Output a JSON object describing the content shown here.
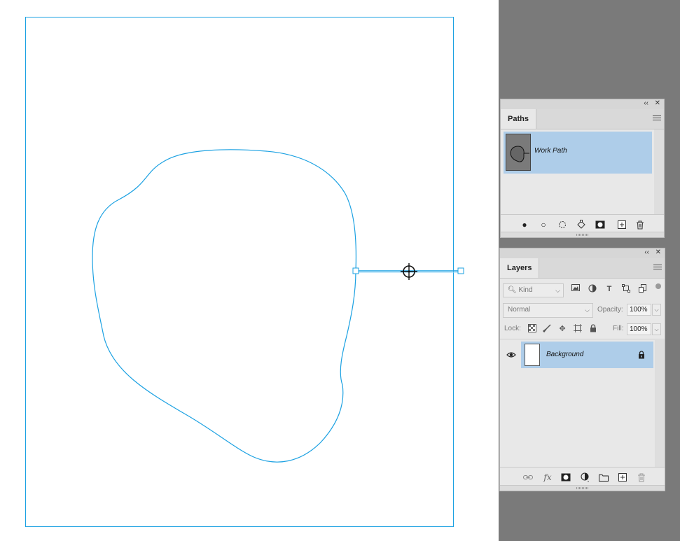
{
  "canvas": {
    "document": "white-document-canvas",
    "path_color": "#1ba1e2",
    "selected_anchor": "path-anchor-point",
    "cursor": "convert-point-crosshair-icon"
  },
  "paths_panel": {
    "tab_label": "Paths",
    "collapse_icon": "double-chevron-left-icon",
    "close_icon": "close-icon",
    "menu_icon": "panel-menu-icon",
    "paths": [
      {
        "name": "Work Path",
        "selected": true
      }
    ],
    "toolbar": [
      "fill-path-icon",
      "stroke-path-icon",
      "load-as-selection-icon",
      "make-work-path-icon",
      "add-mask-icon",
      "new-path-icon",
      "delete-path-icon"
    ]
  },
  "layers_panel": {
    "tab_label": "Layers",
    "collapse_icon": "double-chevron-left-icon",
    "close_icon": "close-icon",
    "menu_icon": "panel-menu-icon",
    "filter": {
      "placeholder": "Kind"
    },
    "blend_mode": "Normal",
    "opacity_label": "Opacity:",
    "opacity_value": "100%",
    "lock_label": "Lock:",
    "fill_label": "Fill:",
    "fill_value": "100%",
    "layers": [
      {
        "name": "Background",
        "visible": true,
        "locked": true,
        "selected": true
      }
    ],
    "toolbar": [
      "link-layers-icon",
      "fx-icon",
      "add-mask-icon",
      "adjustment-layer-icon",
      "group-folder-icon",
      "new-layer-icon",
      "trash-icon"
    ],
    "fx_text": "fx"
  },
  "colors": {
    "selection_blue": "#aecde9",
    "panel_bg": "#e8e8e8",
    "workspace_gray": "#7a7a7a"
  }
}
